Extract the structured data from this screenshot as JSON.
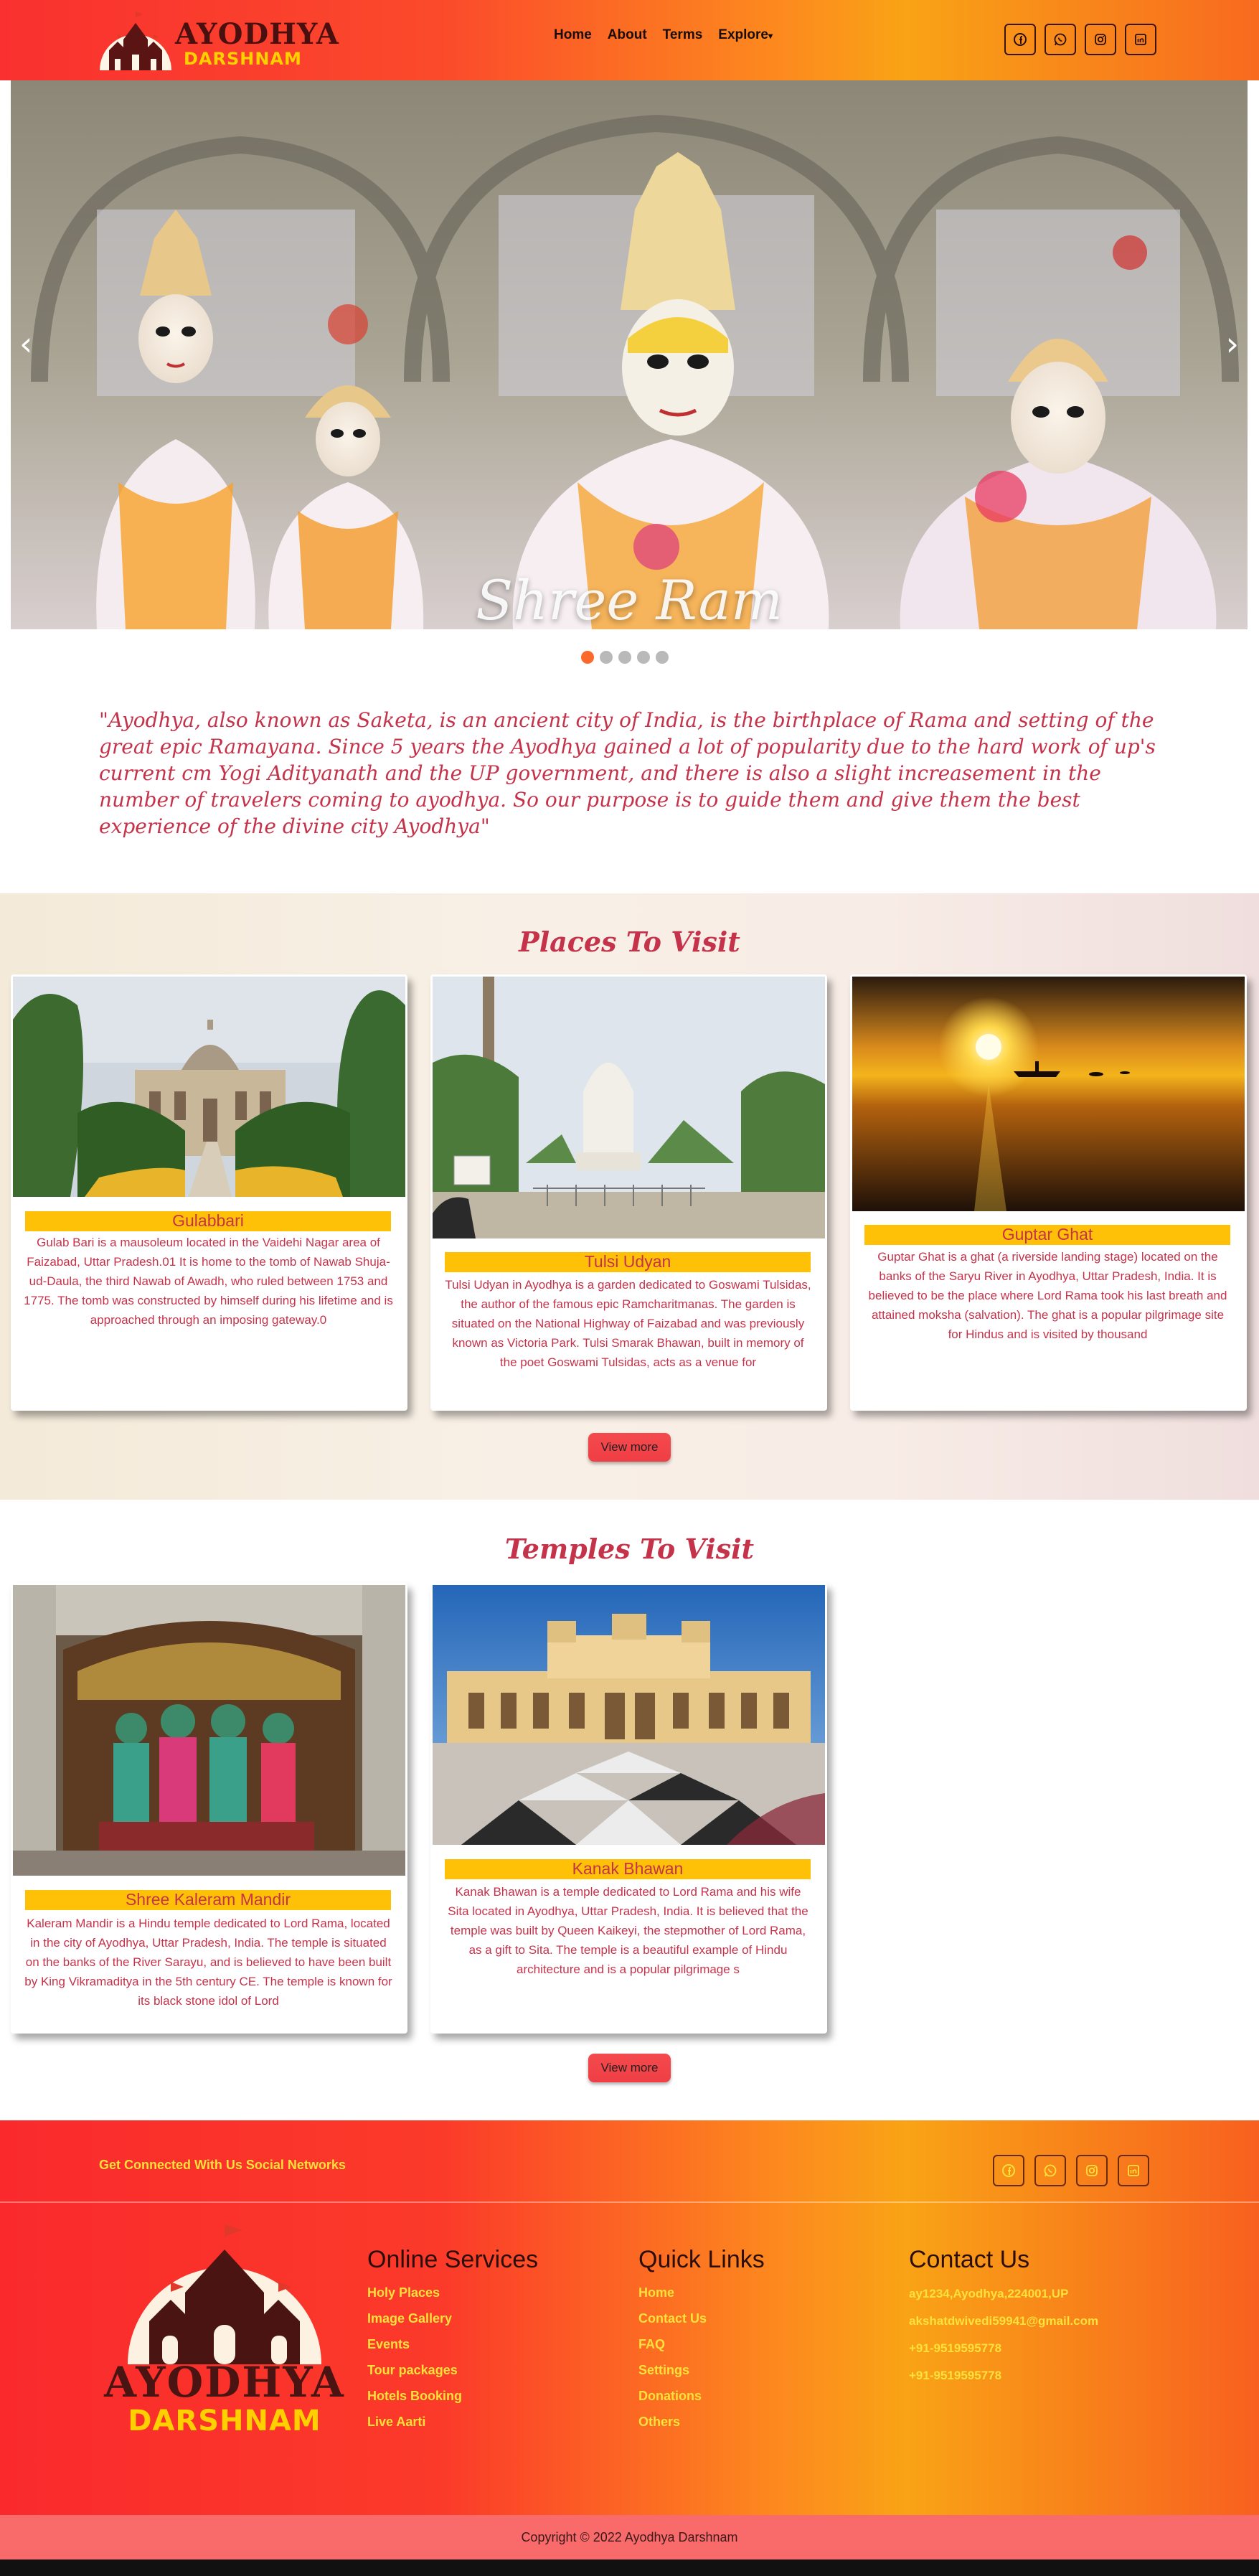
{
  "brand": {
    "line1": "AYODHYA",
    "line2": "DARSHNAM"
  },
  "nav": {
    "items": [
      {
        "label": "Home"
      },
      {
        "label": "About"
      },
      {
        "label": "Terms"
      },
      {
        "label": "Explore"
      }
    ]
  },
  "social": [
    "facebook-icon",
    "whatsapp-icon",
    "instagram-icon",
    "linkedin-icon"
  ],
  "carousel": {
    "caption": "Shree Ram",
    "prev": "‹",
    "next": "›",
    "slide_count": 5,
    "active_index": 0
  },
  "intro": "\"Ayodhya, also known as Saketa, is an ancient city of India, is the birthplace of Rama and setting of the great epic Ramayana. Since 5 years the Ayodhya gained a lot of popularity due to the hard work of up's current cm Yogi Adityanath and the UP government, and there is also a slight increasement in the number of travelers coming to ayodhya. So our purpose is to guide them and give them the best experience of the divine city Ayodhya\"",
  "places": {
    "title": "Places To Visit",
    "cards": [
      {
        "name": "Gulabbari",
        "desc": "Gulab Bari is a mausoleum located in the Vaidehi Nagar area of Faizabad, Uttar Pradesh.01 It is home to the tomb of Nawab Shuja-ud-Daula, the third Nawab of Awadh, who ruled between 1753 and 1775. The tomb was constructed by himself during his lifetime and is approached through an imposing gateway.0"
      },
      {
        "name": "Tulsi Udyan",
        "desc": "Tulsi Udyan in Ayodhya is a garden dedicated to Goswami Tulsidas, the author of the famous epic Ramcharitmanas. The garden is situated on the National Highway of Faizabad and was previously known as Victoria Park. Tulsi Smarak Bhawan, built in memory of the poet Goswami Tulsidas, acts as a venue for"
      },
      {
        "name": "Guptar Ghat",
        "desc": "Guptar Ghat is a ghat (a riverside landing stage) located on the banks of the Saryu River in Ayodhya, Uttar Pradesh, India. It is believed to be the place where Lord Rama took his last breath and attained moksha (salvation). The ghat is a popular pilgrimage site for Hindus and is visited by thousand"
      }
    ],
    "button": "View more"
  },
  "temples": {
    "title": "Temples To Visit",
    "cards": [
      {
        "name": "Shree Kaleram Mandir",
        "desc": "Kaleram Mandir is a Hindu temple dedicated to Lord Rama, located in the city of Ayodhya, Uttar Pradesh, India. The temple is situated on the banks of the River Sarayu, and is believed to have been built by King Vikramaditya in the 5th century CE. The temple is known for its black stone idol of Lord"
      },
      {
        "name": "Kanak Bhawan",
        "desc": "Kanak Bhawan is a temple dedicated to Lord Rama and his wife Sita located in Ayodhya, Uttar Pradesh, India. It is believed that the temple was built by Queen Kaikeyi, the stepmother of Lord Rama, as a gift to Sita. The temple is a beautiful example of Hindu architecture and is a popular pilgrimage s"
      }
    ],
    "button": "View more"
  },
  "footer": {
    "connect": "Get Connected With Us Social Networks",
    "online_services": {
      "title": "Online Services",
      "items": [
        "Holy Places",
        "Image Gallery",
        "Events",
        "Tour packages",
        "Hotels Booking",
        "Live Aarti"
      ]
    },
    "quick_links": {
      "title": "Quick Links",
      "items": [
        "Home",
        "Contact Us",
        "FAQ",
        "Settings",
        "Donations",
        "Others"
      ]
    },
    "contact": {
      "title": "Contact Us",
      "items": [
        "ay1234,Ayodhya,224001,UP",
        "akshatdwivedi59941@gmail.com",
        "+91-9519595778",
        "+91-9519595778"
      ]
    },
    "copyright": "Copyright © 2022 Ayodhya Darshnam"
  },
  "colors": {
    "accent_red": "#c5334b",
    "yellow": "#ffc107",
    "footer_text": "#ffe13a",
    "orange": "#fd8a1e"
  }
}
